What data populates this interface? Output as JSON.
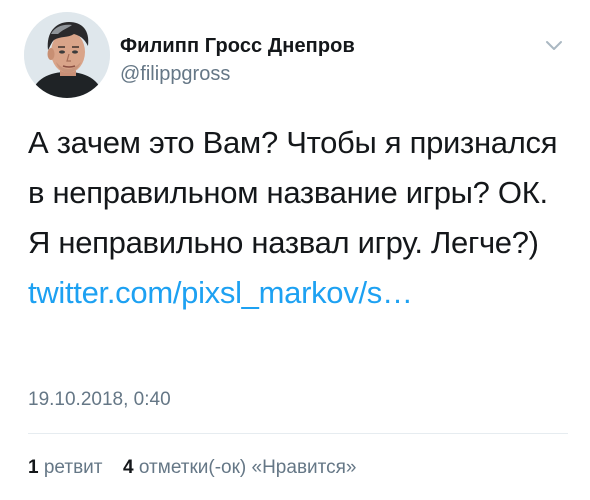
{
  "user": {
    "display_name": "Филипп Гросс Днепров",
    "username": "@filippgross"
  },
  "tweet": {
    "text": "А зачем это Вам? Чтобы я признался в неправильном название игры? ОК. Я неправильно назвал игру. Легче?)",
    "link_text": "twitter.com/pixsl_markov/s…",
    "timestamp": "19.10.2018, 0:40"
  },
  "stats": {
    "retweets_count": "1",
    "retweets_label": "ретвит",
    "likes_count": "4",
    "likes_label": "отметки(-ок) «Нравится»"
  },
  "icons": {
    "menu": "chevron-down-icon"
  },
  "colors": {
    "link": "#1da1f2",
    "secondary_text": "#657786",
    "primary_text": "#14171a"
  }
}
